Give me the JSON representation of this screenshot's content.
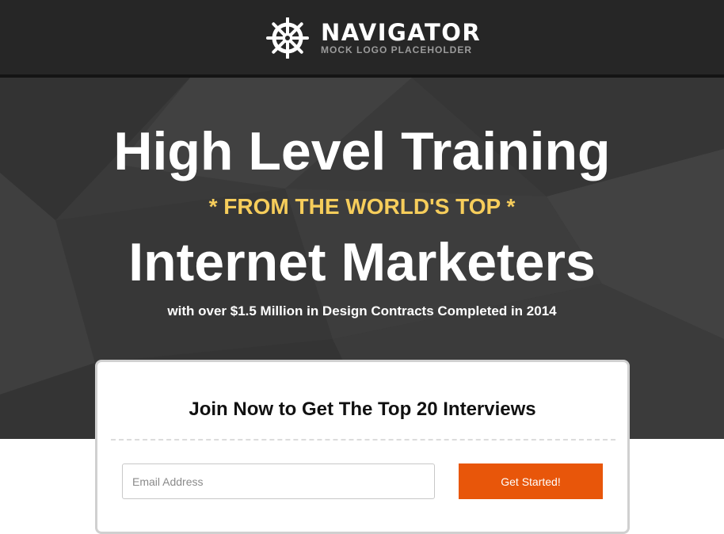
{
  "header": {
    "logo_icon": "ship-wheel-icon",
    "logo_title": "NAVIGATOR",
    "logo_subtitle": "MOCK LOGO PLACEHOLDER"
  },
  "hero": {
    "headline": "High Level Training",
    "tagline": "* FROM THE WORLD'S TOP *",
    "headline2": "Internet Marketers",
    "subheadline": "with over $1.5 Million in Design Contracts Completed in 2014"
  },
  "signup": {
    "title": "Join Now to Get The Top 20 Interviews",
    "email_placeholder": "Email Address",
    "email_value": "",
    "button_label": "Get Started!"
  },
  "colors": {
    "header_bg": "#262626",
    "hero_bg": "#3a3a3a",
    "tagline": "#f6cd5b",
    "accent": "#e8560a"
  }
}
